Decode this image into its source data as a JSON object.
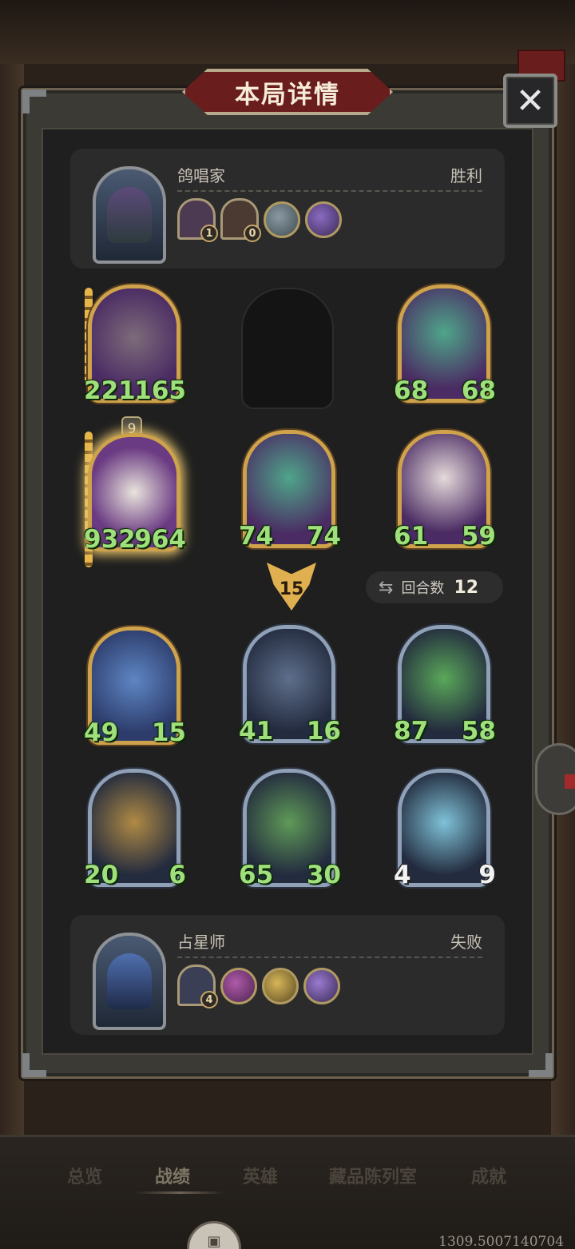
{
  "title": "本局详情",
  "close": {
    "label": "✕"
  },
  "players": {
    "top": {
      "name": "鸽唱家",
      "result": "胜利",
      "trinkets": [
        {
          "count": "1"
        },
        {
          "count": "0"
        }
      ],
      "relics": [
        "grey-beast-relic",
        "purple-door-relic"
      ]
    },
    "bottom": {
      "name": "占星师",
      "result": "失败",
      "trinkets": [
        {
          "count": "4"
        }
      ],
      "relics": [
        "purple-gift-relic",
        "gold-scroll-relic",
        "purple-wand-relic"
      ]
    }
  },
  "board_top": [
    {
      "slot": 1,
      "atk": "221",
      "hp": "165",
      "unit": "raccoon-witch"
    },
    {
      "slot": 2,
      "empty": true
    },
    {
      "slot": 3,
      "atk": "68",
      "hp": "68",
      "unit": "green-snake"
    },
    {
      "slot": 4,
      "atk": "932",
      "hp": "964",
      "unit": "white-goose",
      "level": "9"
    },
    {
      "slot": 5,
      "atk": "74",
      "hp": "74",
      "unit": "green-snake"
    },
    {
      "slot": 6,
      "atk": "61",
      "hp": "59",
      "unit": "masked-rat"
    }
  ],
  "board_bottom": [
    {
      "slot": 1,
      "atk": "49",
      "hp": "15",
      "unit": "blue-dragon"
    },
    {
      "slot": 2,
      "atk": "41",
      "hp": "16",
      "unit": "ghost-spirit"
    },
    {
      "slot": 3,
      "atk": "87",
      "hp": "58",
      "unit": "green-wyvern"
    },
    {
      "slot": 4,
      "atk": "20",
      "hp": "6",
      "unit": "gold-knight"
    },
    {
      "slot": 5,
      "atk": "65",
      "hp": "30",
      "unit": "horned-green-dragon"
    },
    {
      "slot": 6,
      "atk": "4",
      "hp": "9",
      "unit": "ice-dragon"
    }
  ],
  "round": "15",
  "turns": {
    "label": "回合数",
    "value": "12",
    "icon": "swap-arrows-icon"
  },
  "nav": [
    "总览",
    "战绩",
    "英雄",
    "藏品陈列室",
    "成就"
  ],
  "nav_active": "战绩",
  "version": "1309.5007140704",
  "colors": {
    "gold_frame": "#cfa34c",
    "silver_frame": "#8fa0b7",
    "stat_green": "#9fe07c",
    "banner_red": "#6a1d1d"
  }
}
